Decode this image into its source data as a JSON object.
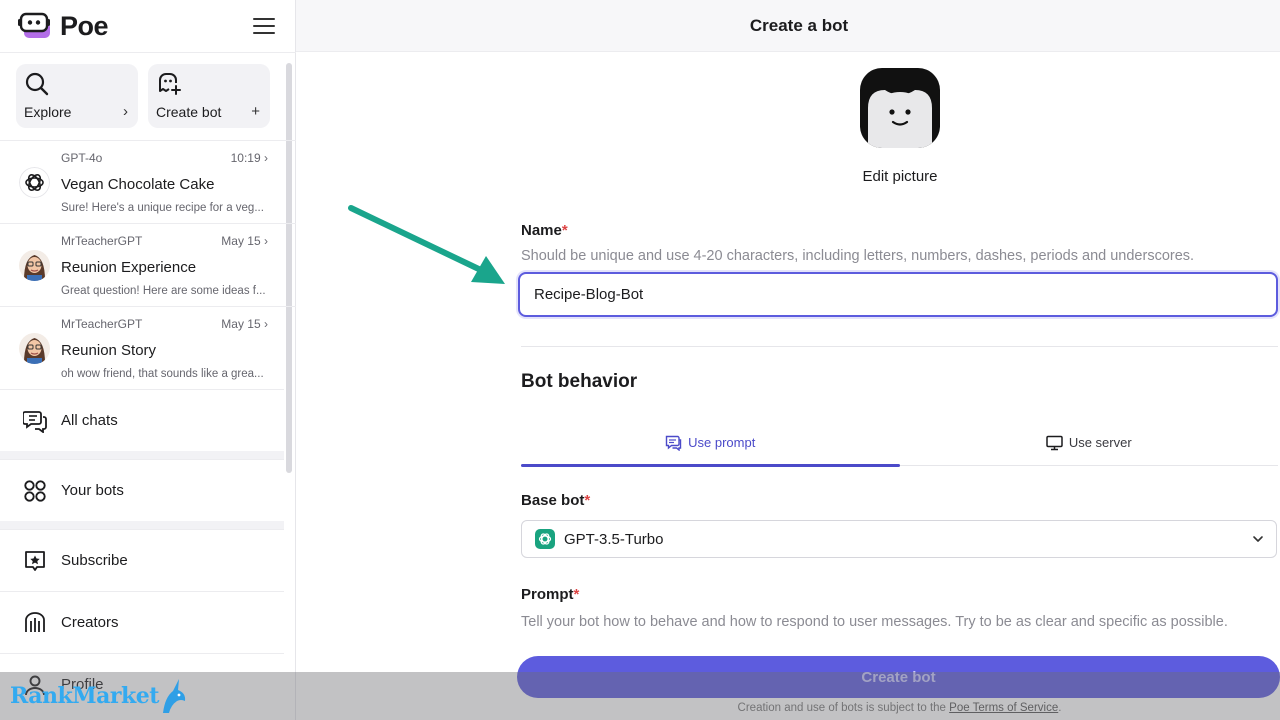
{
  "app": {
    "name": "Poe"
  },
  "header": {
    "title": "Create a bot"
  },
  "sidebar": {
    "quick_actions": [
      {
        "label": "Explore",
        "icon": "search-icon",
        "end": "›"
      },
      {
        "label": "Create bot",
        "icon": "bot-add-icon",
        "end": "+"
      }
    ],
    "chats": [
      {
        "bot": "GPT-4o",
        "time": "10:19",
        "title": "Vegan Chocolate Cake",
        "preview": "Sure! Here's a unique recipe for a veg..."
      },
      {
        "bot": "MrTeacherGPT",
        "time": "May 15",
        "title": "Reunion Experience",
        "preview": "Great question! Here are some ideas f..."
      },
      {
        "bot": "MrTeacherGPT",
        "time": "May 15",
        "title": "Reunion Story",
        "preview": "oh wow friend, that sounds like a grea..."
      }
    ],
    "nav": [
      {
        "label": "All chats",
        "icon": "chat-bubbles-icon"
      },
      {
        "label": "Your bots",
        "icon": "bots-grid-icon"
      },
      {
        "label": "Subscribe",
        "icon": "star-badge-icon"
      },
      {
        "label": "Creators",
        "icon": "creators-icon"
      },
      {
        "label": "Profile",
        "icon": "user-icon"
      }
    ]
  },
  "form": {
    "edit_picture": "Edit picture",
    "name_label": "Name",
    "required_mark": "*",
    "name_hint": "Should be unique and use 4-20 characters, including letters, numbers, dashes, periods and underscores.",
    "name_value": "Recipe-Blog-Bot",
    "section_title": "Bot behavior",
    "tabs": [
      {
        "label": "Use prompt",
        "active": true
      },
      {
        "label": "Use server",
        "active": false
      }
    ],
    "base_bot_label": "Base bot",
    "base_bot_value": "GPT-3.5-Turbo",
    "prompt_label": "Prompt",
    "prompt_hint": "Tell your bot how to behave and how to respond to user messages. Try to be as clear and specific as possible.",
    "submit_label": "Create bot",
    "terms_prefix": "Creation and use of bots is subject to the ",
    "terms_link": "Poe Terms of Service",
    "terms_suffix": "."
  },
  "watermark": {
    "text": "RankMarket"
  },
  "colors": {
    "accent": "#5d5cde",
    "annotation_arrow": "#1aa58c"
  }
}
